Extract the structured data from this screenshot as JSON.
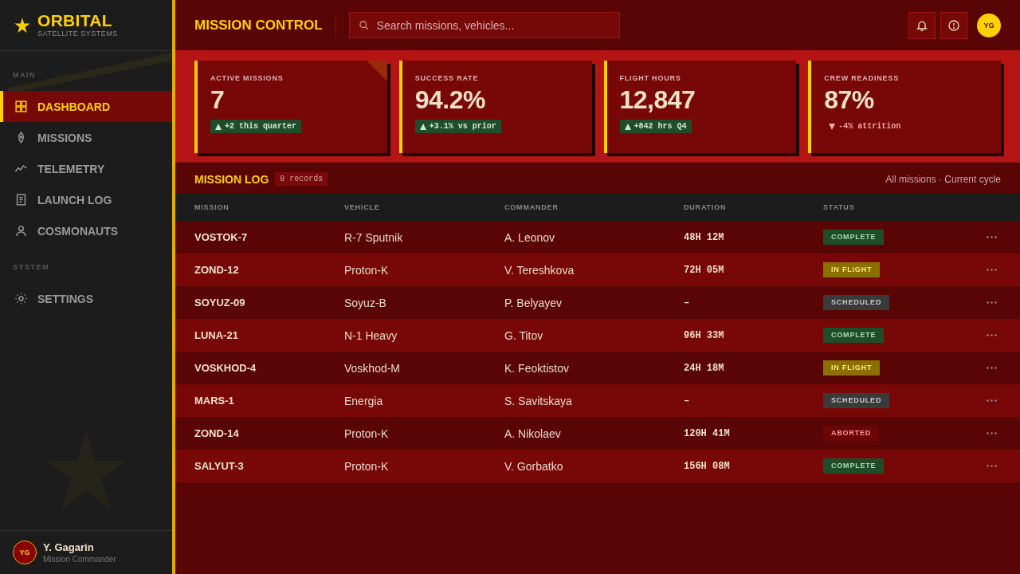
{
  "sidebar": {
    "brand": {
      "name": "ORBITAL",
      "tagline": "SATELLITE SYSTEMS"
    },
    "sections": [
      {
        "title": "MAIN",
        "items": [
          {
            "label": "DASHBOARD",
            "kind": "dashboard",
            "selected": true
          },
          {
            "label": "MISSIONS",
            "kind": "missions",
            "selected": false
          },
          {
            "label": "TELEMETRY",
            "kind": "telemetry",
            "selected": false
          },
          {
            "label": "LAUNCH LOG",
            "kind": "log",
            "selected": false
          },
          {
            "label": "COSMONAUTS",
            "kind": "crew",
            "selected": false
          }
        ]
      },
      {
        "title": "SYSTEM",
        "items": [
          {
            "label": "SETTINGS",
            "kind": "settings",
            "selected": false
          }
        ]
      }
    ],
    "user": {
      "initials": "YG",
      "name": "Y. Gagarin",
      "role": "Mission Commander"
    }
  },
  "header": {
    "title": "MISSION CONTROL",
    "search": {
      "placeholder": "Search missions, vehicles..."
    },
    "actions": [
      {
        "kind": "notifications"
      },
      {
        "kind": "alerts"
      }
    ],
    "avatar": {
      "initials": "YG"
    }
  },
  "stats": [
    {
      "label": "ACTIVE MISSIONS",
      "value": "7",
      "delta": "+2 this quarter",
      "kind": "up",
      "highlighted": true
    },
    {
      "label": "SUCCESS RATE",
      "value": "94.2%",
      "delta": "+3.1% vs prior",
      "kind": "up",
      "highlighted": false
    },
    {
      "label": "FLIGHT HOURS",
      "value": "12,847",
      "delta": "+842 hrs Q4",
      "kind": "up",
      "highlighted": false
    },
    {
      "label": "CREW READINESS",
      "value": "87%",
      "delta": "-4% attrition",
      "kind": "down",
      "highlighted": false
    }
  ],
  "log": {
    "title": "MISSION LOG",
    "count": "8 records",
    "scope": "All missions · Current cycle",
    "columns": [
      "MISSION",
      "VEHICLE",
      "COMMANDER",
      "DURATION",
      "STATUS"
    ],
    "rows": [
      {
        "mission": "VOSTOK-7",
        "vehicle": "R-7 Sputnik",
        "commander": "A. Leonov",
        "duration": "48H 12M",
        "status": "COMPLETE",
        "kind": "complete"
      },
      {
        "mission": "ZOND-12",
        "vehicle": "Proton-K",
        "commander": "V. Tereshkova",
        "duration": "72H 05M",
        "status": "IN FLIGHT",
        "kind": "inflight"
      },
      {
        "mission": "SOYUZ-09",
        "vehicle": "Soyuz-B",
        "commander": "P. Belyayev",
        "duration": "–",
        "status": "SCHEDULED",
        "kind": "scheduled"
      },
      {
        "mission": "LUNA-21",
        "vehicle": "N-1 Heavy",
        "commander": "G. Titov",
        "duration": "96H 33M",
        "status": "COMPLETE",
        "kind": "complete"
      },
      {
        "mission": "VOSKHOD-4",
        "vehicle": "Voskhod-M",
        "commander": "K. Feoktistov",
        "duration": "24H 18M",
        "status": "IN FLIGHT",
        "kind": "inflight"
      },
      {
        "mission": "MARS-1",
        "vehicle": "Energia",
        "commander": "S. Savitskaya",
        "duration": "–",
        "status": "SCHEDULED",
        "kind": "scheduled"
      },
      {
        "mission": "ZOND-14",
        "vehicle": "Proton-K",
        "commander": "A. Nikolaev",
        "duration": "120H 41M",
        "status": "ABORTED",
        "kind": "aborted"
      },
      {
        "mission": "SALYUT-3",
        "vehicle": "Proton-K",
        "commander": "V. Gorbatko",
        "duration": "156H 08M",
        "status": "COMPLETE",
        "kind": "complete"
      }
    ]
  }
}
